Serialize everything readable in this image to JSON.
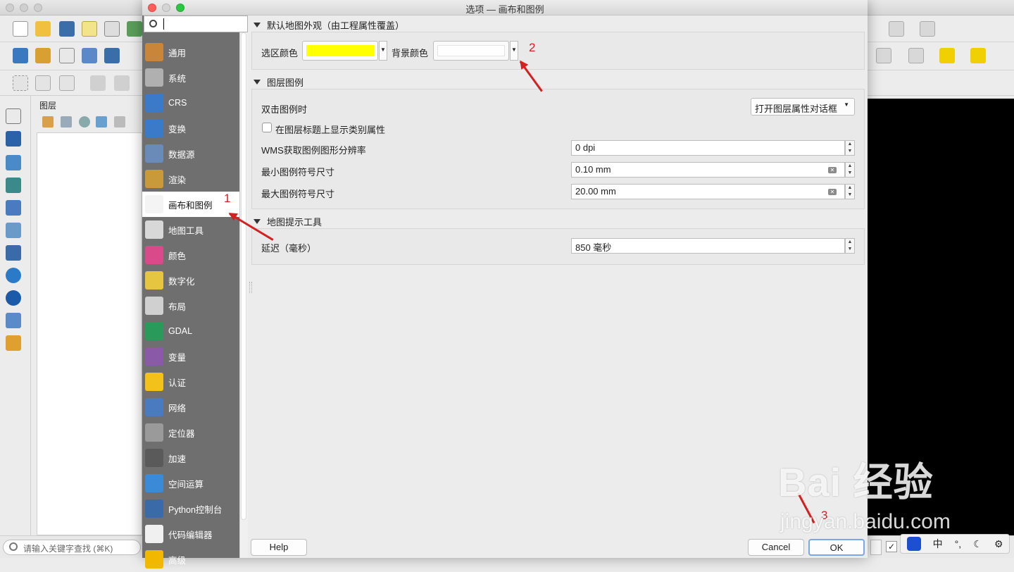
{
  "app": {
    "layers_panel_title": "图层",
    "search_placeholder": "请输入关键字查找 (⌘K)"
  },
  "dialog": {
    "title": "选项 — 画布和图例",
    "search_value": "",
    "sidebar": [
      {
        "label": "通用",
        "icon": "hammer-wrench-icon"
      },
      {
        "label": "系统",
        "icon": "gears-icon"
      },
      {
        "label": "CRS",
        "icon": "globe-icon"
      },
      {
        "label": "变换",
        "icon": "globe-transform-icon"
      },
      {
        "label": "数据源",
        "icon": "table-icon"
      },
      {
        "label": "渲染",
        "icon": "paintbrush-icon"
      },
      {
        "label": "画布和图例",
        "icon": "map-canvas-icon"
      },
      {
        "label": "地图工具",
        "icon": "map-tools-icon"
      },
      {
        "label": "颜色",
        "icon": "color-grid-icon"
      },
      {
        "label": "数字化",
        "icon": "digitize-icon"
      },
      {
        "label": "布局",
        "icon": "layout-icon"
      },
      {
        "label": "GDAL",
        "icon": "gdal-globe-icon"
      },
      {
        "label": "变量",
        "icon": "variable-icon"
      },
      {
        "label": "认证",
        "icon": "lock-icon"
      },
      {
        "label": "网络",
        "icon": "network-icon"
      },
      {
        "label": "定位器",
        "icon": "magnifier-icon"
      },
      {
        "label": "加速",
        "icon": "chip-icon"
      },
      {
        "label": "空间运算",
        "icon": "gear-icon"
      },
      {
        "label": "Python控制台",
        "icon": "python-icon"
      },
      {
        "label": "代码编辑器",
        "icon": "code-file-icon"
      },
      {
        "label": "高级",
        "icon": "warning-icon"
      }
    ],
    "active_index": 6,
    "sections": {
      "appearance": {
        "title": "默认地图外观（由工程属性覆盖）",
        "selection_color_label": "选区颜色",
        "selection_color": "#ffff00",
        "background_color_label": "背景颜色",
        "background_color": "#ffffff"
      },
      "legend": {
        "title": "图层图例",
        "double_click_label": "双击图例时",
        "double_click_value": "打开图层属性对话框",
        "show_classification_label": "在图层标题上显示类别属性",
        "show_classification_checked": false,
        "wms_dpi_label": "WMS获取图例图形分辨率",
        "wms_dpi_value": "0 dpi",
        "min_symbol_label": "最小图例符号尺寸",
        "min_symbol_value": "0.10 mm",
        "max_symbol_label": "最大图例符号尺寸",
        "max_symbol_value": "20.00 mm"
      },
      "maptips": {
        "title": "地图提示工具",
        "delay_label": "延迟（毫秒）",
        "delay_value": "850 毫秒"
      }
    },
    "buttons": {
      "help": "Help",
      "cancel": "Cancel",
      "ok": "OK"
    }
  },
  "annotations": {
    "n1": "1",
    "n2": "2",
    "n3": "3",
    "color": "#d42020"
  },
  "watermark": {
    "line1": "Bai 经验",
    "line2": "jingyan.baidu.com"
  },
  "ime": {
    "items": [
      "中",
      "°,",
      "☾",
      "⚙"
    ]
  }
}
